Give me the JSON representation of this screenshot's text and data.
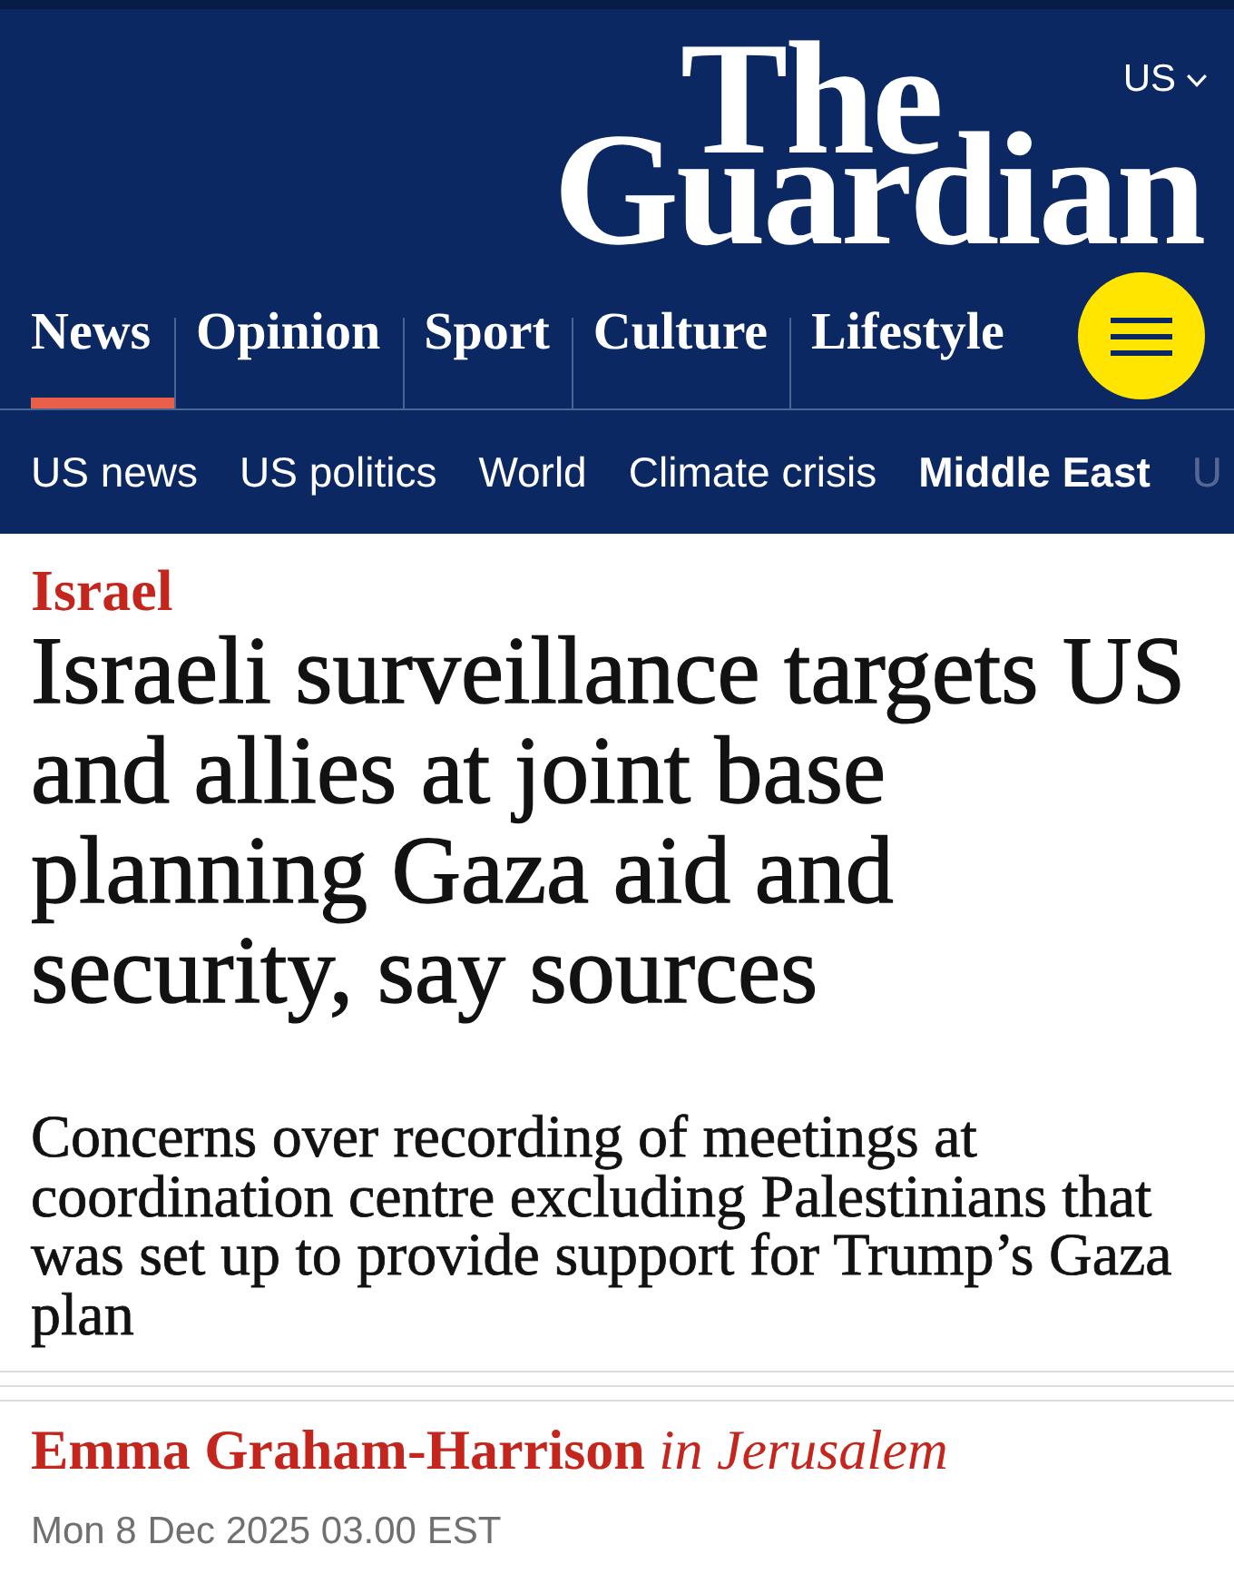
{
  "masthead": {
    "logo": {
      "lines": [
        "The",
        "Guardian"
      ]
    },
    "edition": {
      "label": "US"
    },
    "pillars": [
      {
        "label": "News",
        "selected": true
      },
      {
        "label": "Opinion",
        "selected": false
      },
      {
        "label": "Sport",
        "selected": false
      },
      {
        "label": "Culture",
        "selected": false
      },
      {
        "label": "Lifestyle",
        "selected": false
      }
    ],
    "subnav": [
      {
        "label": "US news",
        "selected": false
      },
      {
        "label": "US politics",
        "selected": false
      },
      {
        "label": "World",
        "selected": false
      },
      {
        "label": "Climate crisis",
        "selected": false
      },
      {
        "label": "Middle East",
        "selected": true
      },
      {
        "label": "U",
        "selected": false
      }
    ]
  },
  "article": {
    "kicker": "Israel",
    "headline": "Israeli surveillance targets US and allies at joint base planning Gaza aid and security, say sources",
    "standfirst": "Concerns over recording of meetings at coordination centre excluding Palestinians that was set up to provide support for Trump’s Gaza plan",
    "byline": "**Emma Graham-Harrison** *in Jerusalem*",
    "dateline": "Mon 8 Dec 2025 03.00 EST"
  }
}
